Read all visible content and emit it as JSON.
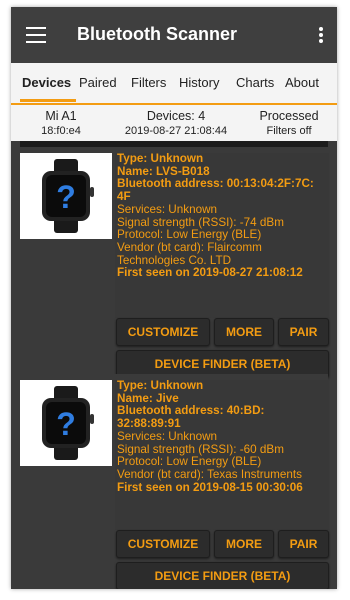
{
  "app": {
    "title": "Bluetooth Scanner"
  },
  "tabs": [
    "Devices",
    "Paired",
    "Filters",
    "History",
    "Charts",
    "About"
  ],
  "status": {
    "device_name": "Mi A1",
    "device_mac": "18:f0:e4",
    "devices_count": "Devices: 4",
    "timestamp": "2019-08-27 21:08:44",
    "processed": "Processed",
    "filters": "Filters off"
  },
  "devices": [
    {
      "type": "Type: Unknown",
      "name": "Name: LVS-B018",
      "address_line1": "Bluetooth address: 00:13:04:2F:7C:",
      "address_line2": "4F",
      "services": "Services: Unknown",
      "signal": "Signal strength (RSSI): -74 dBm",
      "protocol": "Protocol: Low Energy (BLE)",
      "vendor_line1": "Vendor (bt card): Flaircomm",
      "vendor_line2": "Technologies Co. LTD",
      "first_seen": "First seen on 2019-08-27 21:08:12",
      "image_icon": "smartwatch-question-icon"
    },
    {
      "type": "Type: Unknown",
      "name": "Name: Jive",
      "address_line1": "Bluetooth address: 40:BD:",
      "address_line2": "32:88:89:91",
      "services": "Services: Unknown",
      "signal": "Signal strength (RSSI): -60 dBm",
      "protocol": "Protocol: Low Energy (BLE)",
      "vendor_line1": "Vendor (bt card): Texas Instruments",
      "vendor_line2": "",
      "first_seen": "First seen on 2019-08-15 00:30:06",
      "image_icon": "smartwatch-question-icon"
    }
  ],
  "buttons": {
    "customize": "CUSTOMIZE",
    "more": "MORE",
    "pair": "PAIR",
    "device_finder": "DEVICE FINDER (BETA)"
  },
  "colors": {
    "accent": "#f39c12",
    "background": "#3a3a3a",
    "appbar": "#3f3f3f"
  }
}
